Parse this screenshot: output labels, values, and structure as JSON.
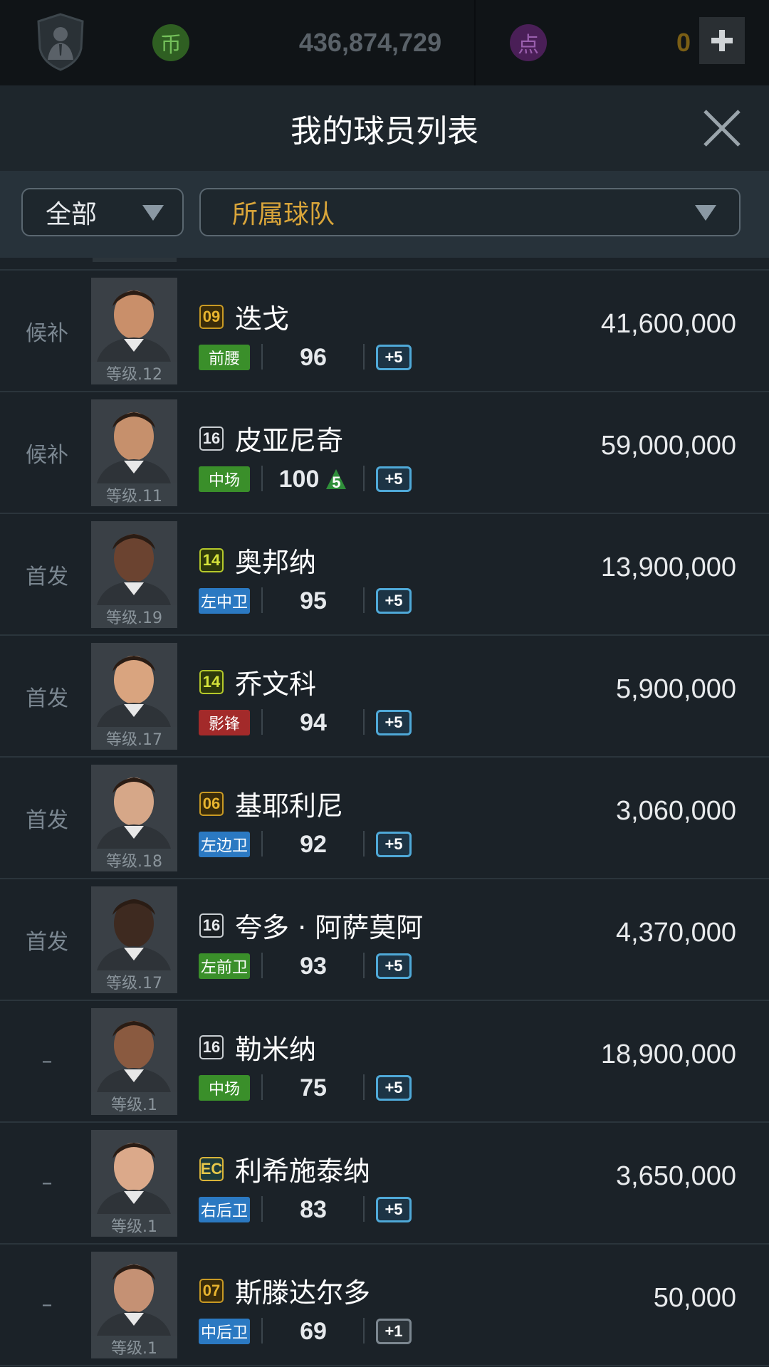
{
  "topbar": {
    "coin_icon_text": "币",
    "coins": "436,874,729",
    "point_icon_text": "点",
    "points": "0"
  },
  "header": {
    "title": "我的球员列表"
  },
  "filters": {
    "category": "全部",
    "team": "所属球队"
  },
  "colors": {
    "pos_green": "#3a8f2a",
    "pos_blue": "#2b79c2",
    "pos_red": "#a32a2a",
    "accent_gold": "#d9a53a",
    "boost_blue": "#4fa9d8"
  },
  "players": [
    {
      "status": "候补",
      "level": "等级.12",
      "season": "09",
      "season_style": "gold",
      "name": "迭戈",
      "position": "前腰",
      "pos_color": "green",
      "ovr": "96",
      "ovr_up": "",
      "boost": "+5",
      "value": "41,600,000"
    },
    {
      "status": "候补",
      "level": "等级.11",
      "season": "16",
      "season_style": "dark",
      "name": "皮亚尼奇",
      "position": "中场",
      "pos_color": "green",
      "ovr": "100",
      "ovr_up": "5",
      "boost": "+5",
      "value": "59,000,000"
    },
    {
      "status": "首发",
      "level": "等级.19",
      "season": "14",
      "season_style": "yellowgreen",
      "name": "奥邦纳",
      "position": "左中卫",
      "pos_color": "blue",
      "ovr": "95",
      "ovr_up": "",
      "boost": "+5",
      "value": "13,900,000"
    },
    {
      "status": "首发",
      "level": "等级.17",
      "season": "14",
      "season_style": "yellowgreen",
      "name": "乔文科",
      "position": "影锋",
      "pos_color": "red",
      "ovr": "94",
      "ovr_up": "",
      "boost": "+5",
      "value": "5,900,000"
    },
    {
      "status": "首发",
      "level": "等级.18",
      "season": "06",
      "season_style": "gold",
      "name": "基耶利尼",
      "position": "左边卫",
      "pos_color": "blue",
      "ovr": "92",
      "ovr_up": "",
      "boost": "+5",
      "value": "3,060,000"
    },
    {
      "status": "首发",
      "level": "等级.17",
      "season": "16",
      "season_style": "dark",
      "name": "夸多 · 阿萨莫阿",
      "position": "左前卫",
      "pos_color": "green",
      "ovr": "93",
      "ovr_up": "",
      "boost": "+5",
      "value": "4,370,000"
    },
    {
      "status": "–",
      "level": "等级.1",
      "season": "16",
      "season_style": "dark",
      "name": "勒米纳",
      "position": "中场",
      "pos_color": "green",
      "ovr": "75",
      "ovr_up": "",
      "boost": "+5",
      "value": "18,900,000"
    },
    {
      "status": "–",
      "level": "等级.1",
      "season": "EC",
      "season_style": "ec",
      "name": "利希施泰纳",
      "position": "右后卫",
      "pos_color": "blue",
      "ovr": "83",
      "ovr_up": "",
      "boost": "+5",
      "value": "3,650,000"
    },
    {
      "status": "–",
      "level": "等级.1",
      "season": "07",
      "season_style": "gold",
      "name": "斯滕达尔多",
      "position": "中后卫",
      "pos_color": "blue",
      "ovr": "69",
      "ovr_up": "",
      "boost": "+1",
      "value": "50,000"
    }
  ]
}
